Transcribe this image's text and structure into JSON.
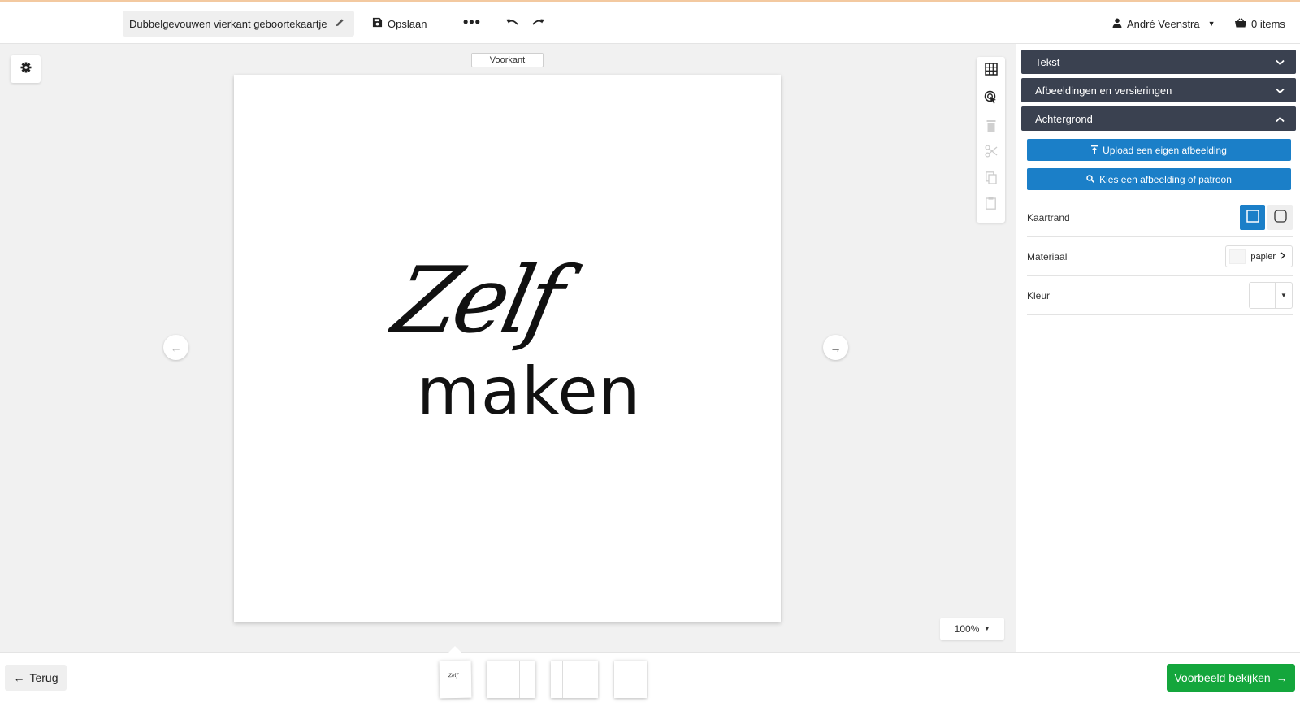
{
  "header": {
    "doc_title": "Dubbelgevouwen vierkant geboortekaartje",
    "save_label": "Opslaan",
    "more_label": "•••",
    "user_name": "André Veenstra",
    "cart_label": "0 items"
  },
  "canvas": {
    "side_label": "Voorkant",
    "card_text_script": "Zelf",
    "card_text_sans": "maken",
    "zoom_label": "100%"
  },
  "panel": {
    "sections": [
      {
        "label": "Tekst",
        "state": "collapsed"
      },
      {
        "label": "Afbeeldingen en versieringen",
        "state": "collapsed"
      },
      {
        "label": "Achtergrond",
        "state": "expanded"
      }
    ],
    "upload_button": "Upload een eigen afbeelding",
    "choose_button": "Kies een afbeelding of patroon",
    "card_border_label": "Kaartrand",
    "material_label": "Materiaal",
    "material_value": "papier",
    "color_label": "Kleur"
  },
  "footer": {
    "back_label": "Terug",
    "preview_label": "Voorbeeld bekijken"
  },
  "colors": {
    "accent_blue": "#1b7fc8",
    "panel_header": "#3a4150",
    "preview_green": "#14a63c"
  }
}
